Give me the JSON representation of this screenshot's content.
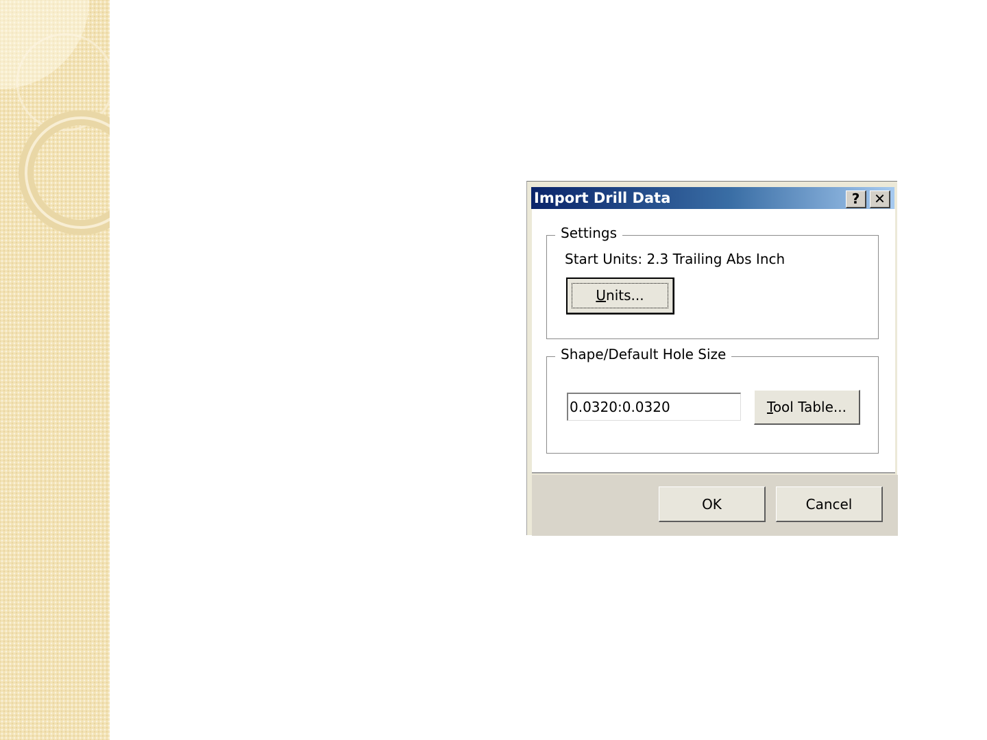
{
  "dialog": {
    "title": "Import Drill Data",
    "help_button": "?",
    "close_button": "✕",
    "settings": {
      "group_label": "Settings",
      "start_units": "Start Units: 2.3 Trailing Abs Inch",
      "units_button": {
        "mnemonic": "U",
        "rest": "nits..."
      }
    },
    "shape": {
      "group_label": "Shape/Default Hole Size",
      "hole_size_value": "0.0320:0.0320",
      "tool_table_button": {
        "mnemonic": "T",
        "rest": "ool Table..."
      }
    },
    "ok_label": "OK",
    "cancel_label": "Cancel"
  },
  "colors": {
    "slide_strip": "#f3e3b6",
    "titlebar_start": "#0a246a",
    "titlebar_end": "#a6caf0",
    "dialog_face": "#d9d5ca"
  }
}
